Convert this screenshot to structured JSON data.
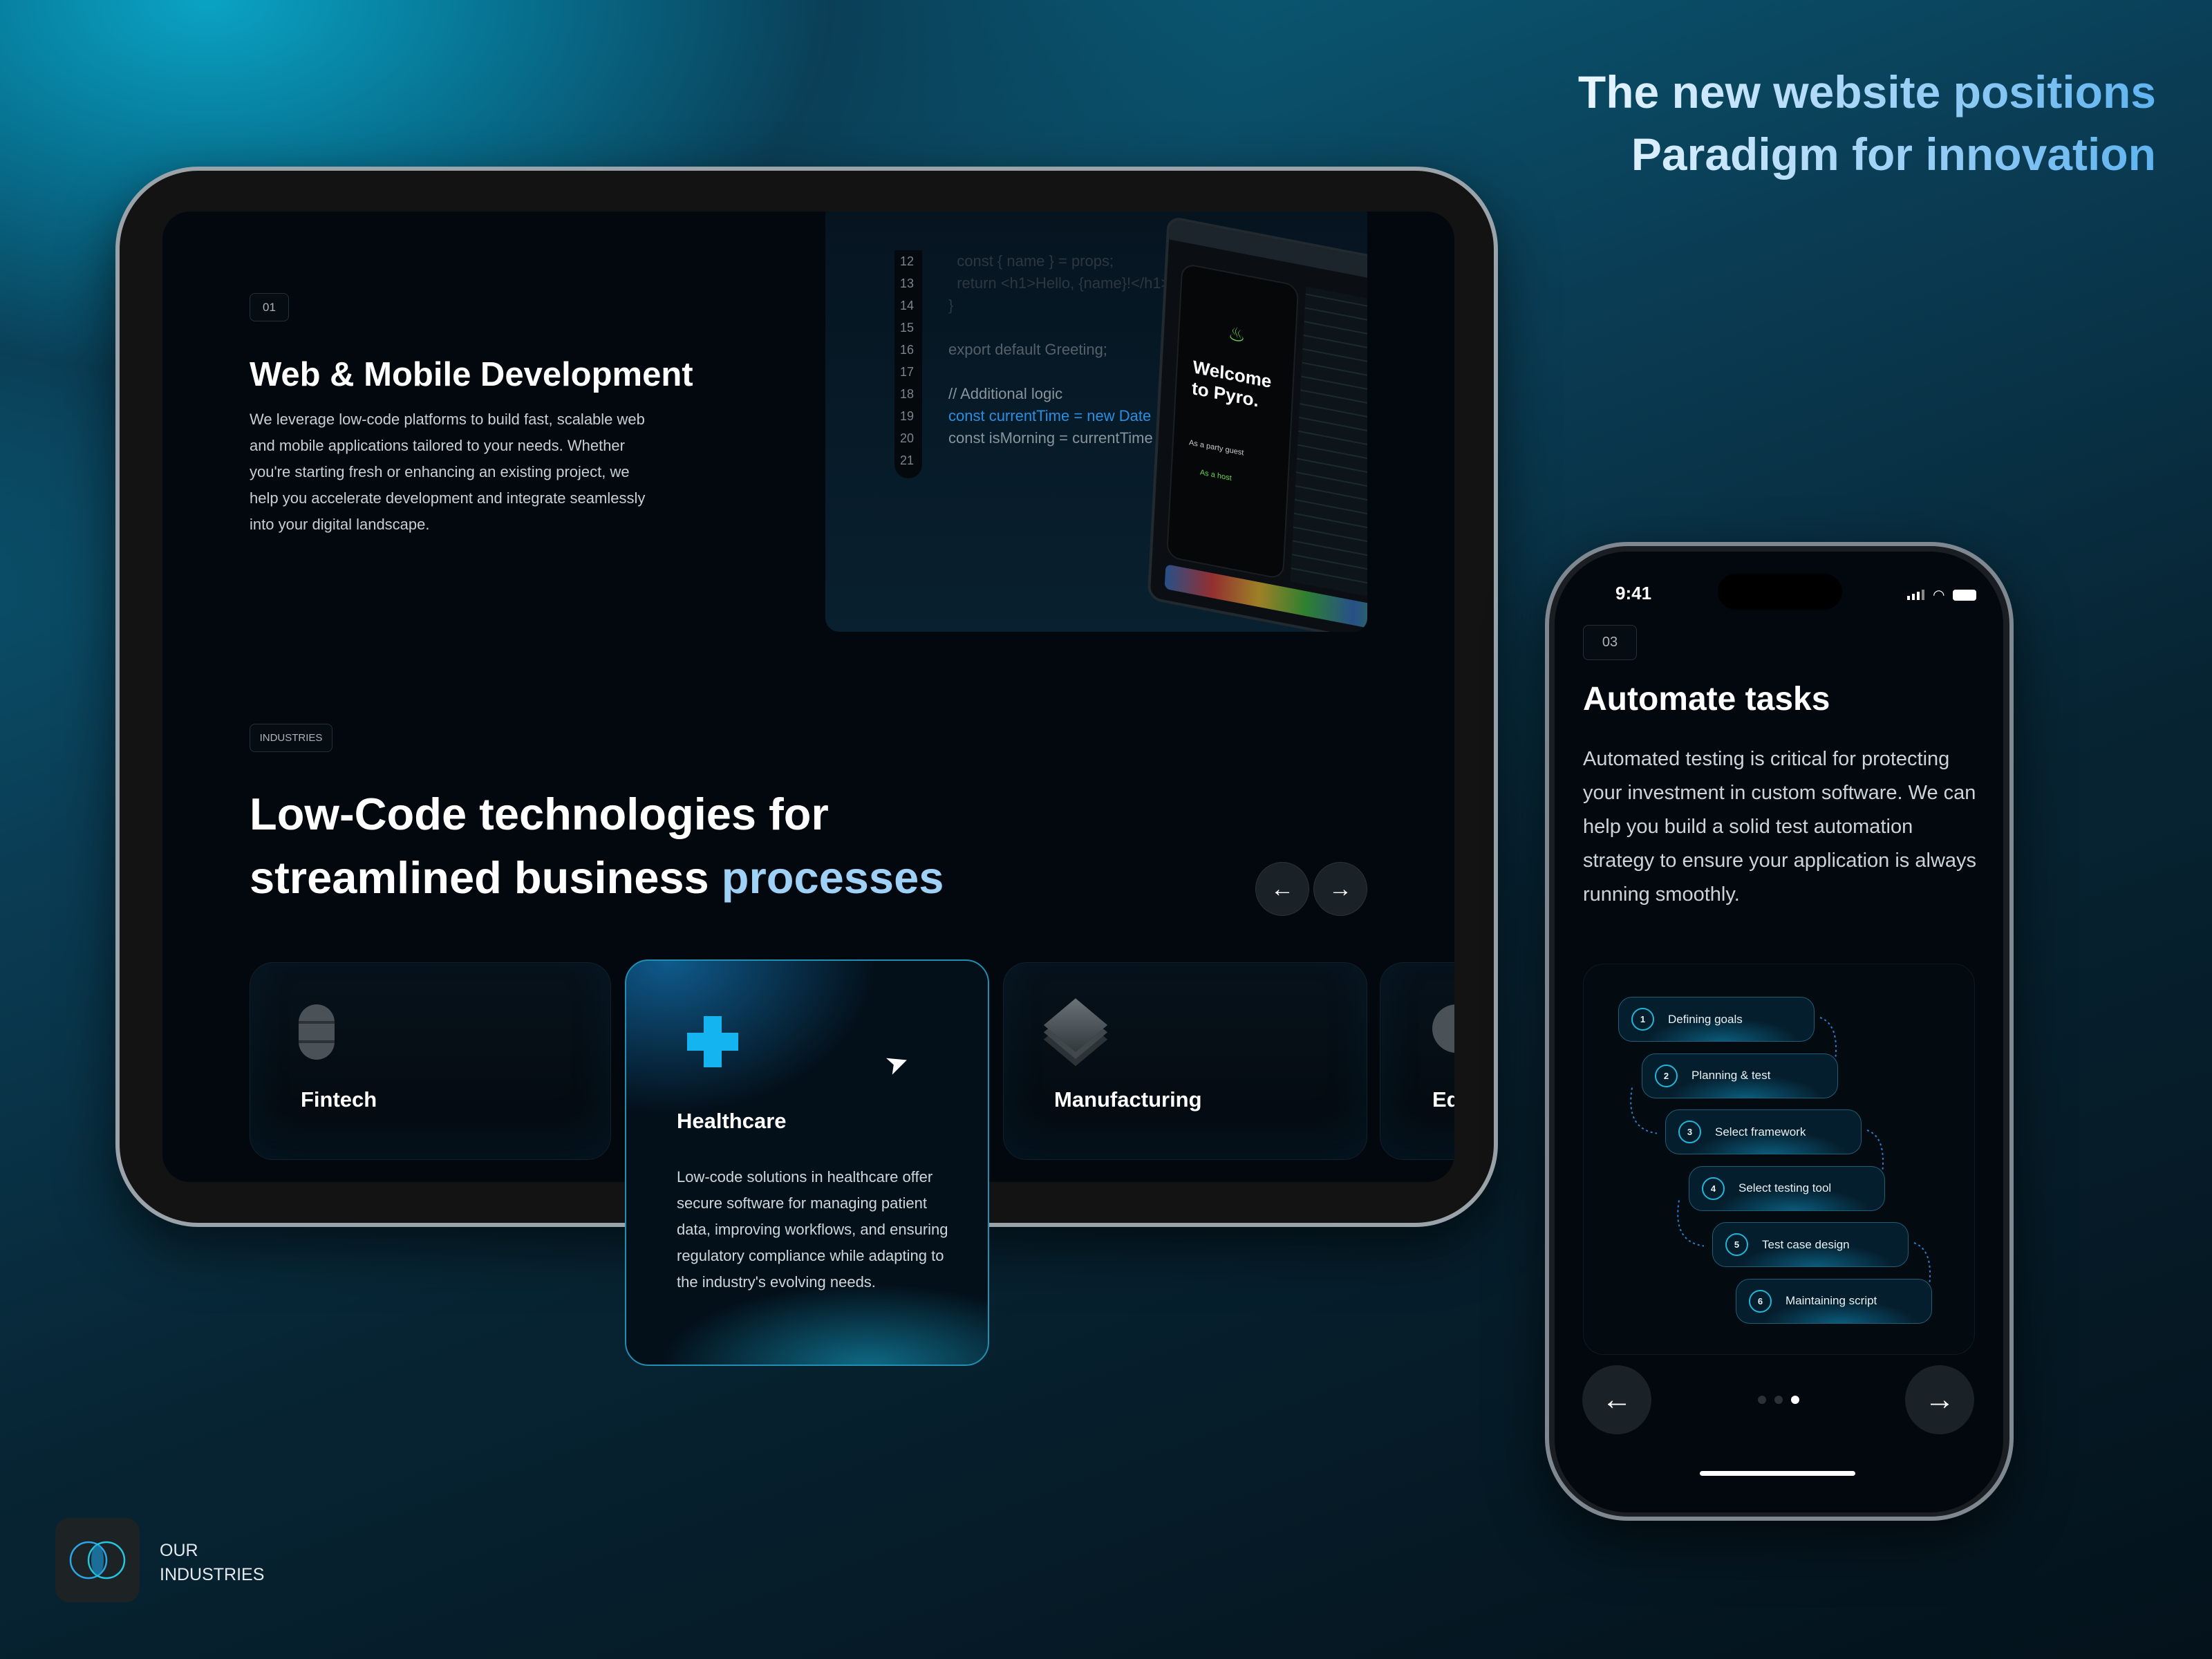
{
  "headline": {
    "line1_a": "The new website ",
    "line1_b": "positions",
    "line2_a": "Paradigm for ",
    "line2_b": "innovation"
  },
  "tablet": {
    "service": {
      "number": "01",
      "title": "Web & Mobile Development",
      "description": "We leverage low-code platforms to build fast, scalable web and mobile applications tailored to your needs. Whether you're starting fresh or enhancing an existing project, we help you accelerate development and integrate seamlessly into your digital landscape."
    },
    "code": {
      "lines": [
        {
          "n": "12",
          "text": "  const { name } = props;",
          "color": "#2c3740"
        },
        {
          "n": "13",
          "text": "  return <h1>Hello, {name}!</h1>;",
          "color": "#2c3740"
        },
        {
          "n": "14",
          "text": "}",
          "color": "#2c3740"
        },
        {
          "n": "15",
          "text": "",
          "color": "#55606a"
        },
        {
          "n": "16",
          "text": "export default Greeting;",
          "color": "#55606a"
        },
        {
          "n": "17",
          "text": "",
          "color": "#55606a"
        },
        {
          "n": "18",
          "text": "// Additional logic",
          "color": "#8a949b"
        },
        {
          "n": "19",
          "text": "const currentTime = new Date",
          "color": "#2a8fe0"
        },
        {
          "n": "20",
          "text": "const isMorning = currentTime",
          "color": "#8a949b"
        },
        {
          "n": "21",
          "text": "",
          "color": "#8a949b"
        }
      ]
    },
    "laptop": {
      "welcome": "Welcome to Pyro.",
      "option1": "As a party guest",
      "option2": "As a host"
    },
    "industries_badge": "INDUSTRIES",
    "heading": {
      "line1": "Low-Code technologies for",
      "line2_a": "streamlined business ",
      "line2_b": "processes"
    },
    "prev_icon": "arrow-left-icon",
    "next_icon": "arrow-right-icon",
    "cards": [
      {
        "name": "Fintech",
        "icon": "coin-stack-icon"
      },
      {
        "name": "Healthcare",
        "icon": "medical-cross-icon",
        "description": "Low-code solutions in healthcare offer secure software for managing patient data, improving workflows, and ensuring regulatory compliance while adapting to the industry's evolving needs.",
        "accent": "#14b4f0"
      },
      {
        "name": "Manufacturing",
        "icon": "layers-icon"
      },
      {
        "name": "Ed",
        "icon": "sphere-icon"
      }
    ]
  },
  "phone": {
    "time": "9:41",
    "number": "03",
    "title": "Automate tasks",
    "description": "Automated testing is critical for protecting your investment in custom software. We can help you build a solid test automation strategy to ensure your application is always running smoothly.",
    "steps": [
      {
        "n": "1",
        "label": "Defining goals"
      },
      {
        "n": "2",
        "label": "Planning & test"
      },
      {
        "n": "3",
        "label": "Select framework"
      },
      {
        "n": "4",
        "label": "Select testing tool"
      },
      {
        "n": "5",
        "label": "Test case design"
      },
      {
        "n": "6",
        "label": "Maintaining script"
      }
    ],
    "pagination": {
      "total": 3,
      "active": 3
    }
  },
  "footer": {
    "line1": "OUR",
    "line2": "INDUSTRIES"
  }
}
